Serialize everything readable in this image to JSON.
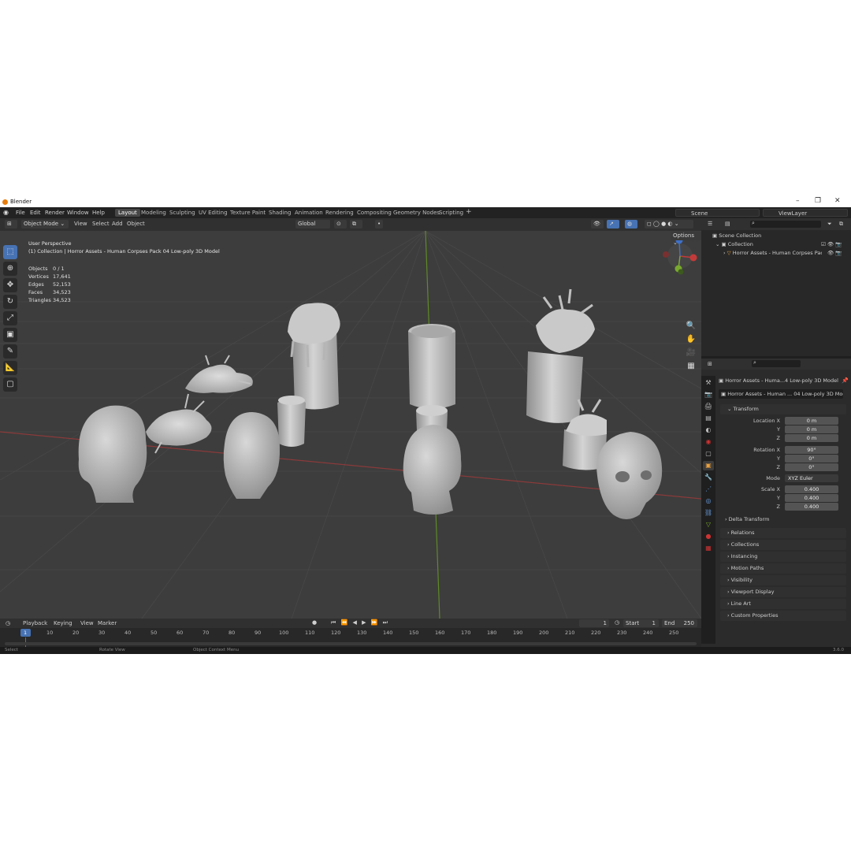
{
  "window": {
    "title": "Blender"
  },
  "menu": [
    "File",
    "Edit",
    "Render",
    "Window",
    "Help"
  ],
  "workspaces": [
    "Layout",
    "Modeling",
    "Sculpting",
    "UV Editing",
    "Texture Paint",
    "Shading",
    "Animation",
    "Rendering",
    "Compositing",
    "Geometry Nodes",
    "Scripting"
  ],
  "active_workspace": "Layout",
  "scene": "Scene",
  "view_layer": "ViewLayer",
  "viewport_header": {
    "mode": "Object Mode",
    "menus": [
      "View",
      "Select",
      "Add",
      "Object"
    ],
    "orientation": "Global",
    "options": "Options"
  },
  "viewport": {
    "view_name": "User Perspective",
    "collection_line": "(1) Collection | Horror Assets - Human Corpses Pack 04 Low-poly 3D Model",
    "stats": [
      {
        "label": "Objects",
        "value": "0 / 1"
      },
      {
        "label": "Vertices",
        "value": "17,641"
      },
      {
        "label": "Edges",
        "value": "52,153"
      },
      {
        "label": "Faces",
        "value": "34,523"
      },
      {
        "label": "Triangles",
        "value": "34,523"
      }
    ],
    "gizmo": {
      "x": "X",
      "y": "Y",
      "z": "Z"
    }
  },
  "outliner": {
    "root": "Scene Collection",
    "collection": "Collection",
    "object": "Horror Assets - Human Corpses Pacl"
  },
  "properties": {
    "object_name": "Horror Assets - Huma...4 Low-poly 3D Model",
    "data_name": "Horror Assets - Human ... 04 Low-poly 3D Model",
    "transform_title": "Transform",
    "location_label": "Location X",
    "rotation_label": "Rotation X",
    "scale_label": "Scale X",
    "y_label": "Y",
    "z_label": "Z",
    "mode_label": "Mode",
    "location": [
      "0 m",
      "0 m",
      "0 m"
    ],
    "rotation": [
      "90°",
      "0°",
      "0°"
    ],
    "mode": "XYZ Euler",
    "scale": [
      "0.400",
      "0.400",
      "0.400"
    ],
    "delta": "Delta Transform",
    "sections": [
      "Relations",
      "Collections",
      "Instancing",
      "Motion Paths",
      "Visibility",
      "Viewport Display",
      "Line Art",
      "Custom Properties"
    ]
  },
  "timeline": {
    "menus": [
      "Playback",
      "Keying",
      "View",
      "Marker"
    ],
    "current_frame": "1",
    "start_label": "Start",
    "start": "1",
    "end_label": "End",
    "end": "250",
    "ruler": [
      "1",
      "10",
      "20",
      "30",
      "40",
      "50",
      "60",
      "70",
      "80",
      "90",
      "100",
      "110",
      "120",
      "130",
      "140",
      "150",
      "160",
      "170",
      "180",
      "190",
      "200",
      "210",
      "220",
      "230",
      "240",
      "250"
    ]
  },
  "status": {
    "left": "Select",
    "mid": "Rotate View",
    "right": "Object Context Menu",
    "version": "3.6.0"
  },
  "colors": {
    "accent": "#4772b3",
    "bg": "#1d1d1d",
    "viewport": "#3d3d3d",
    "axis_x": "#c33a3a",
    "axis_y": "#79a82f",
    "axis_z": "#3e70c7"
  }
}
